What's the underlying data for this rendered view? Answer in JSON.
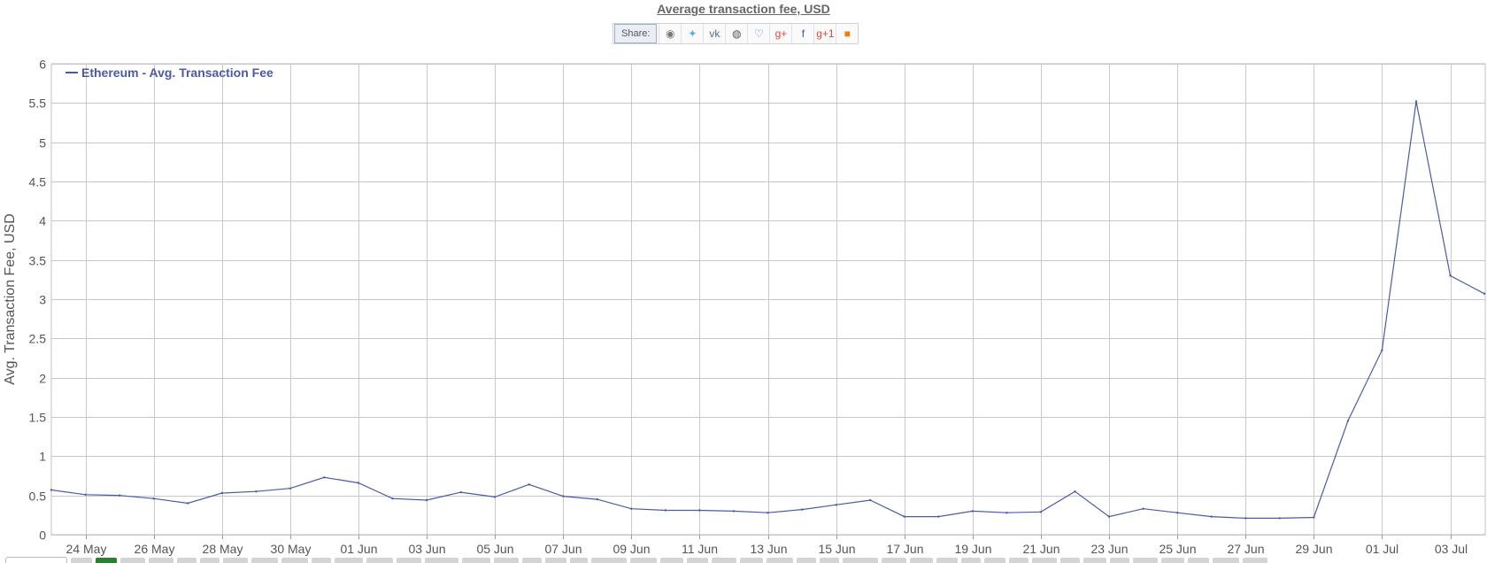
{
  "title": "Average transaction fee, USD",
  "share": {
    "label": "Share:",
    "icons": [
      {
        "name": "reddit-icon",
        "glyph": "◉",
        "color": "#777777"
      },
      {
        "name": "twitter-icon",
        "glyph": "✦",
        "color": "#55acee"
      },
      {
        "name": "vk-icon",
        "glyph": "vk",
        "color": "#4a6e95"
      },
      {
        "name": "weibo-icon",
        "glyph": "◍",
        "color": "#555555"
      },
      {
        "name": "like-icon",
        "glyph": "♡",
        "color": "#4a78c0"
      },
      {
        "name": "google-plus-icon",
        "glyph": "g+",
        "color": "#dd4b39"
      },
      {
        "name": "facebook-icon",
        "glyph": "f",
        "color": "#3b5998"
      },
      {
        "name": "google-plus-one-icon",
        "glyph": "g+1",
        "color": "#dd4b39"
      },
      {
        "name": "blogger-icon",
        "glyph": "■",
        "color": "#f57d00"
      }
    ]
  },
  "chart_data": {
    "type": "line",
    "ylabel": "Avg. Transaction Fee, USD",
    "xlabel": "",
    "ylim": [
      0,
      6
    ],
    "yticks": [
      "0",
      "0.5",
      "1",
      "1.5",
      "2",
      "2.5",
      "3",
      "3.5",
      "4",
      "4.5",
      "5",
      "5.5",
      "6"
    ],
    "grid": true,
    "legend_position": "top-left",
    "x_tick_labels": [
      "24 May",
      "26 May",
      "28 May",
      "30 May",
      "01 Jun",
      "03 Jun",
      "05 Jun",
      "07 Jun",
      "09 Jun",
      "11 Jun",
      "13 Jun",
      "15 Jun",
      "17 Jun",
      "19 Jun",
      "21 Jun",
      "23 Jun",
      "25 Jun",
      "27 Jun",
      "29 Jun",
      "01 Jul",
      "03 Jul"
    ],
    "x": [
      "2017-05-23",
      "2017-05-24",
      "2017-05-25",
      "2017-05-26",
      "2017-05-27",
      "2017-05-28",
      "2017-05-29",
      "2017-05-30",
      "2017-05-31",
      "2017-06-01",
      "2017-06-02",
      "2017-06-03",
      "2017-06-04",
      "2017-06-05",
      "2017-06-06",
      "2017-06-07",
      "2017-06-08",
      "2017-06-09",
      "2017-06-10",
      "2017-06-11",
      "2017-06-12",
      "2017-06-13",
      "2017-06-14",
      "2017-06-15",
      "2017-06-16",
      "2017-06-17",
      "2017-06-18",
      "2017-06-19",
      "2017-06-20",
      "2017-06-21",
      "2017-06-22",
      "2017-06-23",
      "2017-06-24",
      "2017-06-25",
      "2017-06-26",
      "2017-06-27",
      "2017-06-28",
      "2017-06-29",
      "2017-06-30",
      "2017-07-01",
      "2017-07-02",
      "2017-07-03",
      "2017-07-04"
    ],
    "series": [
      {
        "name": "Ethereum - Avg. Transaction Fee",
        "color": "#4b5aa8",
        "values": [
          0.57,
          0.51,
          0.5,
          0.46,
          0.4,
          0.53,
          0.55,
          0.59,
          0.73,
          0.66,
          0.46,
          0.44,
          0.54,
          0.48,
          0.64,
          0.49,
          0.45,
          0.33,
          0.31,
          0.31,
          0.3,
          0.28,
          0.32,
          0.38,
          0.44,
          0.23,
          0.23,
          0.3,
          0.28,
          0.29,
          0.55,
          0.23,
          0.33,
          0.28,
          0.23,
          0.21,
          0.21,
          0.22,
          1.45,
          2.35,
          5.52,
          3.3,
          3.07
        ]
      }
    ]
  }
}
